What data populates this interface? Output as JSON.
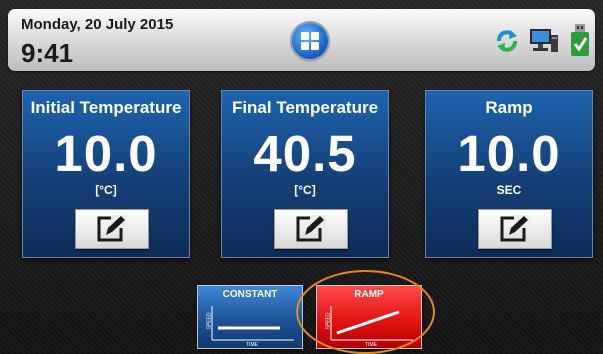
{
  "status_bar": {
    "date": "Monday, 20 July 2015",
    "time": "9:41",
    "icons": [
      "home-icon",
      "sync-icon",
      "computer-icon",
      "usb-icon"
    ]
  },
  "cards": [
    {
      "title": "Initial Temperature",
      "value": "10.0",
      "unit": "[°C]",
      "action_icon": "edit-icon"
    },
    {
      "title": "Final Temperature",
      "value": "40.5",
      "unit": "[°C]",
      "action_icon": "edit-icon"
    },
    {
      "title": "Ramp",
      "value": "10.0",
      "unit": "SEC",
      "action_icon": "edit-icon"
    }
  ],
  "modes": [
    {
      "label": "CONSTANT",
      "y_axis": "SPEED",
      "x_axis": "TIME",
      "color": "#1b4f93"
    },
    {
      "label": "RAMP",
      "y_axis": "SPEED",
      "x_axis": "TIME",
      "color": "#e01010",
      "highlighted": true
    }
  ],
  "colors": {
    "card_blue": "#143f76",
    "ramp_red": "#e01010",
    "highlight_orange": "#e08a27"
  }
}
